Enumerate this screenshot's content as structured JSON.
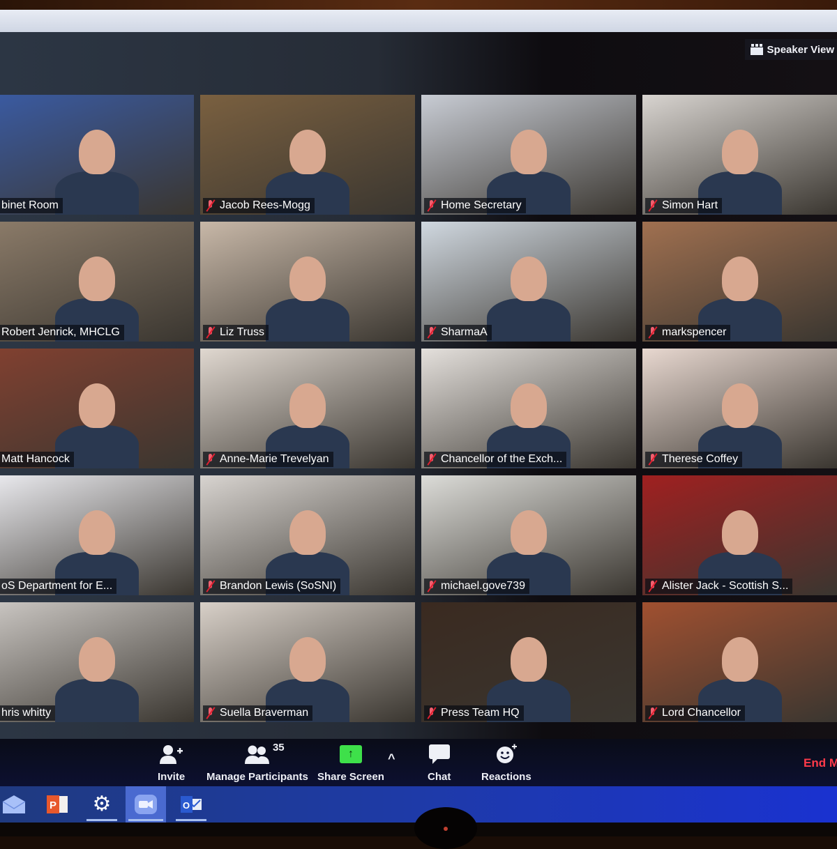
{
  "app": {
    "name": "Zoom Meeting",
    "view_mode_label": "Speaker View"
  },
  "participants_count": "35",
  "tiles": [
    {
      "name": "Cabinet Room",
      "shown_name": "binet Room",
      "muted": false,
      "bg": "#3a5aa0"
    },
    {
      "name": "Jacob Rees-Mogg",
      "shown_name": "Jacob Rees-Mogg",
      "muted": true,
      "bg": "#7a6040"
    },
    {
      "name": "Home Secretary",
      "shown_name": "Home Secretary",
      "muted": true,
      "bg": "#c8ccd4"
    },
    {
      "name": "Simon Hart",
      "shown_name": "Simon Hart",
      "muted": true,
      "bg": "#d8d4d0"
    },
    {
      "name": "Robert Jenrick, MHCLG",
      "shown_name": "Robert Jenrick, MHCLG",
      "muted": false,
      "bg": "#8a7a68"
    },
    {
      "name": "Liz Truss",
      "shown_name": "Liz Truss",
      "muted": true,
      "bg": "#c8b8a8"
    },
    {
      "name": "SharmaA",
      "shown_name": "SharmaA",
      "muted": true,
      "bg": "#d0d8e0"
    },
    {
      "name": "markspencer",
      "shown_name": "markspencer",
      "muted": true,
      "bg": "#a07050"
    },
    {
      "name": "Matt Hancock",
      "shown_name": "Matt Hancock",
      "muted": false,
      "bg": "#804030"
    },
    {
      "name": "Anne-Marie Trevelyan",
      "shown_name": "Anne-Marie Trevelyan",
      "muted": true,
      "bg": "#e0d8d0"
    },
    {
      "name": "Chancellor of the Exch...",
      "shown_name": "Chancellor of the Exch...",
      "muted": true,
      "bg": "#e4e0dc"
    },
    {
      "name": "Therese Coffey",
      "shown_name": "Therese Coffey",
      "muted": true,
      "bg": "#e8d8d0"
    },
    {
      "name": "SoS Department for E...",
      "shown_name": "oS Department for E...",
      "muted": false,
      "bg": "#e8e8ec"
    },
    {
      "name": "Brandon Lewis (SoSNI)",
      "shown_name": "Brandon Lewis (SoSNI)",
      "muted": true,
      "bg": "#d8d4d0"
    },
    {
      "name": "michael.gove739",
      "shown_name": "michael.gove739",
      "muted": true,
      "bg": "#dcdcd8"
    },
    {
      "name": "Alister Jack - Scottish S...",
      "shown_name": "Alister Jack - Scottish S...",
      "muted": true,
      "bg": "#a02020"
    },
    {
      "name": "Chris whitty",
      "shown_name": "hris whitty",
      "muted": false,
      "bg": "#c8c4c0"
    },
    {
      "name": "Suella Braverman",
      "shown_name": "Suella Braverman",
      "muted": true,
      "bg": "#d8d0c8"
    },
    {
      "name": "Press Team HQ",
      "shown_name": "Press Team HQ",
      "muted": true,
      "bg": "#3a2a20"
    },
    {
      "name": "Lord Chancellor",
      "shown_name": "Lord Chancellor",
      "muted": true,
      "bg": "#a05030"
    }
  ],
  "toolbar": {
    "invite": "Invite",
    "manage_participants": "Manage Participants",
    "share_screen": "Share Screen",
    "chat": "Chat",
    "reactions": "Reactions",
    "end_meeting": "End M",
    "share_arrow": "↑",
    "caret": "^"
  },
  "taskbar": {
    "items": [
      {
        "name": "Mail",
        "active": false
      },
      {
        "name": "PowerPoint",
        "active": false
      },
      {
        "name": "Settings",
        "active": false
      },
      {
        "name": "Zoom",
        "active": true
      },
      {
        "name": "Outlook",
        "active": false
      }
    ]
  },
  "colors": {
    "accent_green": "#3ee04a",
    "end_red": "#ff3a4a",
    "mute_red": "#e02030",
    "taskbar_blue": "#1e3aa8"
  }
}
